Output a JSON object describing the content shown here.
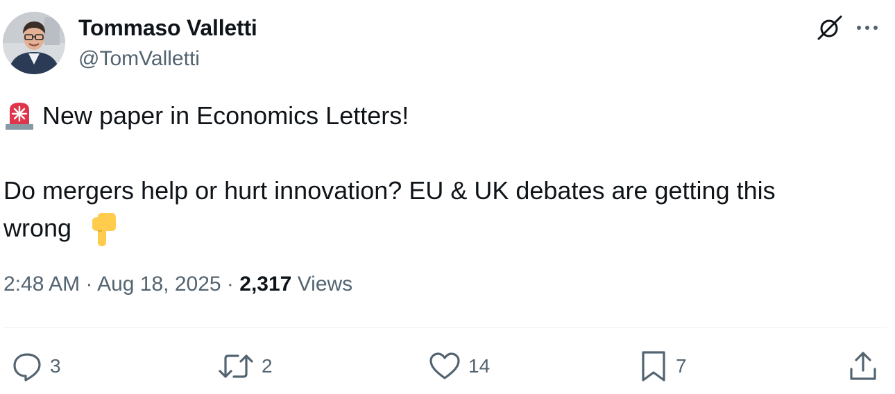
{
  "author": {
    "display_name": "Tommaso Valletti",
    "handle": "@TomValletti",
    "avatar_icon": "profile-photo"
  },
  "header_actions": {
    "grok_icon": "grok-icon",
    "more_icon": "more-horizontal-icon"
  },
  "tweet": {
    "line1_emoji": "rotating-light-icon",
    "line1": "New paper in Economics Letters!",
    "line2": "Do mergers help or hurt innovation? EU & UK debates are getting this",
    "line3": "wrong",
    "line3_emoji": "backhand-index-pointing-down-icon"
  },
  "meta": {
    "time": "2:48 AM",
    "separator": " · ",
    "date": "Aug 18, 2025",
    "views_count": "2,317",
    "views_label": "Views"
  },
  "actions": {
    "replies": {
      "icon": "reply-icon",
      "count": "3"
    },
    "reposts": {
      "icon": "repost-icon",
      "count": "2"
    },
    "likes": {
      "icon": "heart-icon",
      "count": "14"
    },
    "bookmarks": {
      "icon": "bookmark-icon",
      "count": "7"
    },
    "share": {
      "icon": "share-icon"
    }
  },
  "colors": {
    "text_primary": "#0f1419",
    "text_secondary": "#536471",
    "divider": "#eff3f4",
    "siren_red": "#e0344a",
    "emoji_yellow": "#ffcc4d"
  }
}
